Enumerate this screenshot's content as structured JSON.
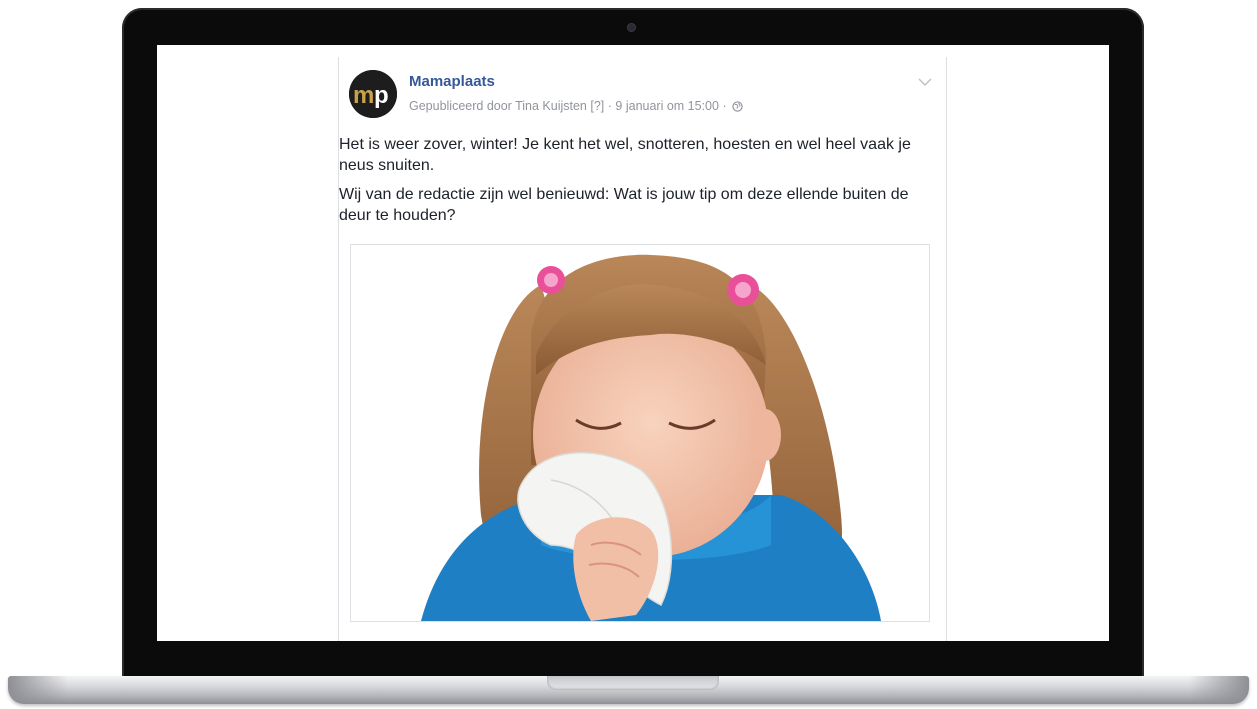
{
  "post": {
    "page_name": "Mamaplaats",
    "avatar_initials": "mp",
    "published_by": "Gepubliceerd door Tina Kuijsten",
    "help_marker": "[?]",
    "separator": "·",
    "date": "9 januari om 15:00",
    "paragraphs": [
      "Het is weer zover, winter! Je kent het wel, snotteren, hoesten en wel heel vaak je neus snuiten.",
      "Wij van de redactie zijn wel benieuwd: Wat is jouw tip om deze ellende buiten de deur te houden?"
    ]
  },
  "colors": {
    "page_name": "#365899",
    "meta_text": "#90949c",
    "body_text": "#1d2129",
    "avatar_bg": "#1d1d1d",
    "avatar_m": "#c9a24a",
    "avatar_p": "#ffffff"
  },
  "icons": [
    "chevron-down-icon",
    "globe-icon"
  ]
}
